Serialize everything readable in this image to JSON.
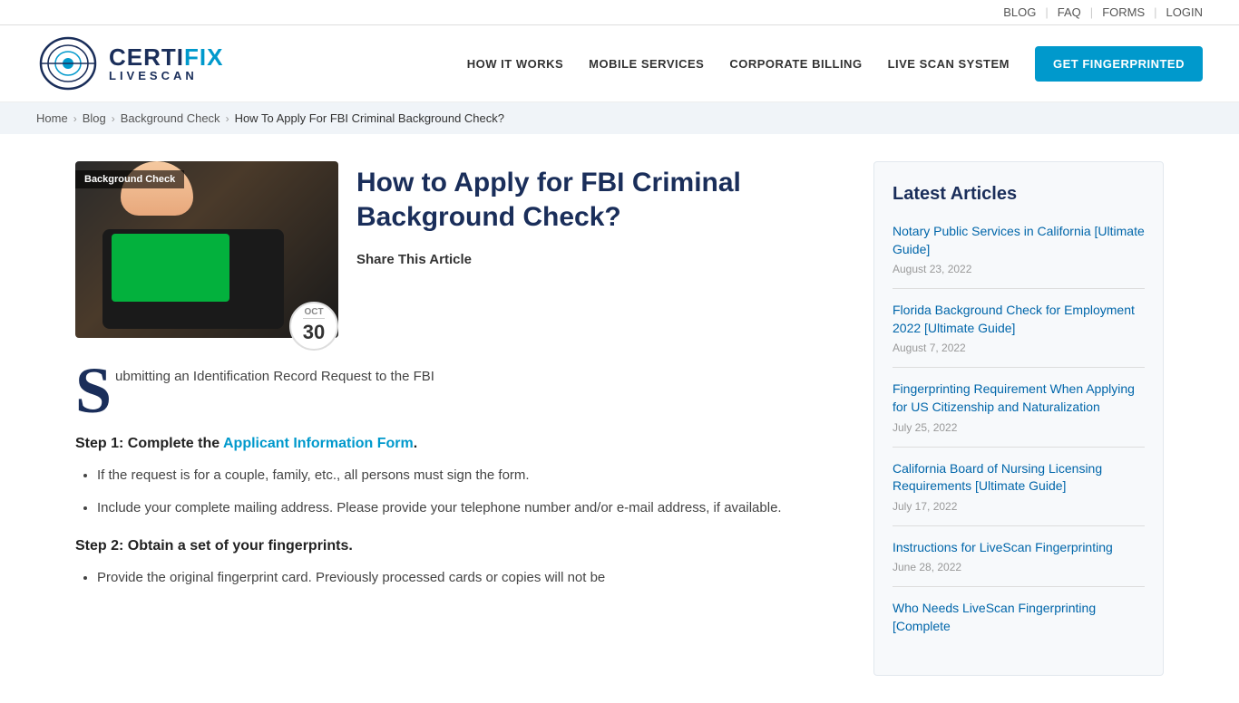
{
  "topbar": {
    "links": [
      "BLOG",
      "FAQ",
      "FORMS",
      "LOGIN"
    ]
  },
  "header": {
    "logo_certifix": "CERTIFIX",
    "logo_livescan": "LIVESCAN",
    "nav": [
      "HOW IT WORKS",
      "MOBILE SERVICES",
      "CORPORATE BILLING",
      "LIVE SCAN SYSTEM"
    ],
    "cta_button": "GET FINGERPRINTED"
  },
  "breadcrumb": {
    "home": "Home",
    "blog": "Blog",
    "category": "Background Check",
    "current": "How To Apply For FBI Criminal Background Check?"
  },
  "article": {
    "category_badge": "Background Check",
    "date_month": "OCT",
    "date_day": "30",
    "title": "How to Apply for FBI Criminal Background Check?",
    "share_label": "Share This Article",
    "drop_cap": "S",
    "drop_cap_rest": "ubmitting an Identification Record Request to the FBI",
    "step1_label": "Step 1: Complete the ",
    "step1_link_text": "Applicant Information Form",
    "step1_end": ".",
    "bullet1_1": "If the request is for a couple, family, etc., all persons must sign the form.",
    "bullet1_2": "Include your complete mailing address. Please provide your telephone number and/or e-mail address, if available.",
    "step2_label": "Step 2: Obtain a set of your fingerprints.",
    "bullet2_1": "Provide the original fingerprint card. Previously processed cards or copies will not be"
  },
  "sidebar": {
    "title": "Latest Articles",
    "articles": [
      {
        "title": "Notary Public Services in California [Ultimate Guide]",
        "date": "August 23, 2022"
      },
      {
        "title": "Florida Background Check for Employment 2022 [Ultimate Guide]",
        "date": "August 7, 2022"
      },
      {
        "title": "Fingerprinting Requirement When Applying for US Citizenship and Naturalization",
        "date": "July 25, 2022"
      },
      {
        "title": "California Board of Nursing Licensing Requirements [Ultimate Guide]",
        "date": "July 17, 2022"
      },
      {
        "title": "Instructions for LiveScan Fingerprinting",
        "date": "June 28, 2022"
      },
      {
        "title": "Who Needs LiveScan Fingerprinting [Complete",
        "date": ""
      }
    ]
  }
}
